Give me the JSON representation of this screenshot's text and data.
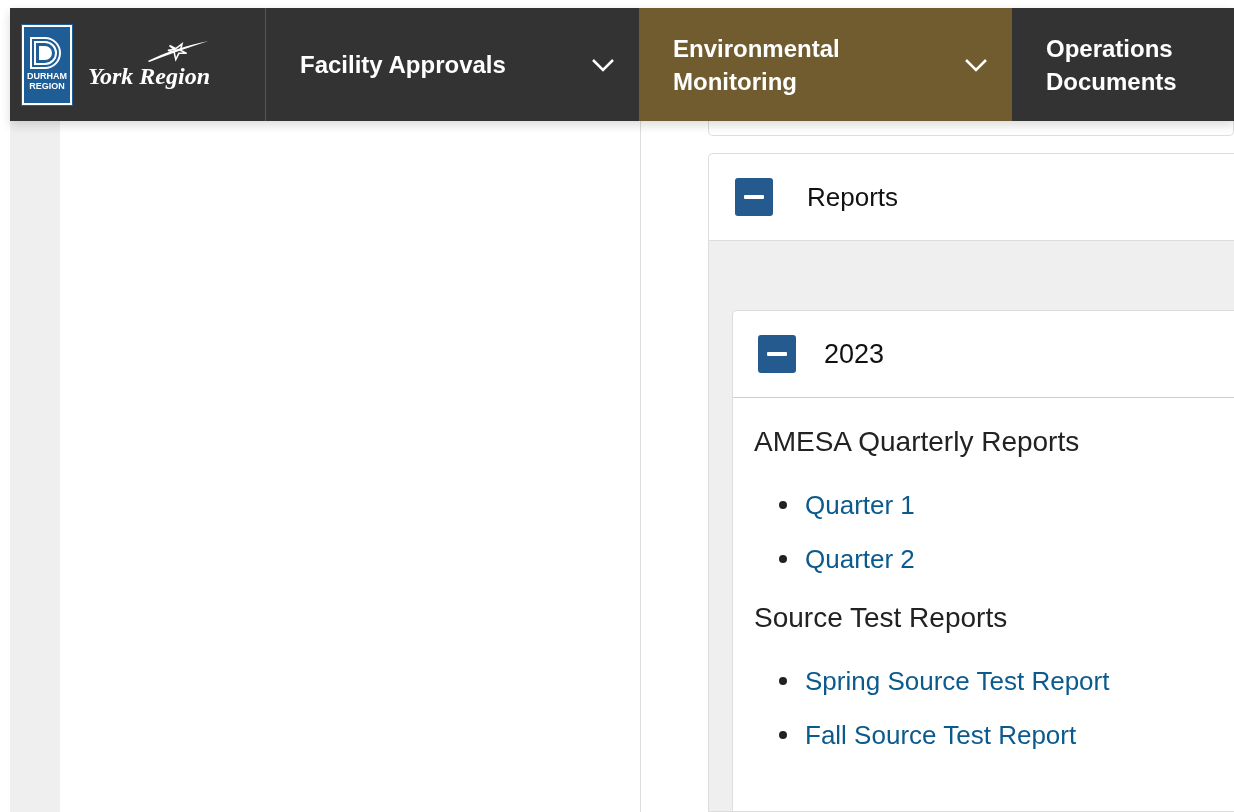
{
  "logos": {
    "durham": [
      "DURHAM",
      "REGION"
    ],
    "york": "York Region"
  },
  "nav": [
    {
      "label": "Facility Approvals",
      "has_dropdown": true,
      "selected": false
    },
    {
      "label": "Environmental Monitoring",
      "has_dropdown": true,
      "selected": true
    },
    {
      "label": "Operations Documents",
      "has_dropdown": false,
      "selected": false
    }
  ],
  "accordion": {
    "title": "Reports",
    "expanded": true,
    "children": [
      {
        "title": "2023",
        "expanded": true,
        "sections": [
          {
            "heading": "AMESA Quarterly Reports",
            "links": [
              "Quarter 1",
              "Quarter 2"
            ]
          },
          {
            "heading": "Source Test Reports",
            "links": [
              "Spring Source Test Report",
              "Fall Source Test Report"
            ]
          }
        ]
      }
    ]
  }
}
